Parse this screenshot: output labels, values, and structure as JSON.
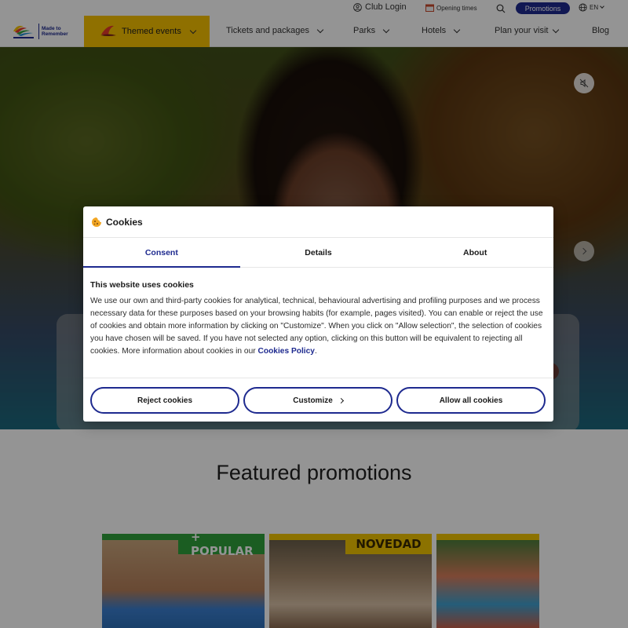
{
  "topbar": {
    "club_login": "Club Login",
    "opening_times": "Opening times",
    "promotions": "Promotions",
    "language": "EN"
  },
  "logo": {
    "tagline_1": "Made to",
    "tagline_2": "Remember"
  },
  "nav": {
    "items": [
      {
        "label": "Themed events"
      },
      {
        "label": "Tickets and packages"
      },
      {
        "label": "Parks"
      },
      {
        "label": "Hotels"
      },
      {
        "label": "Plan your visit"
      },
      {
        "label": "Blog"
      }
    ]
  },
  "main": {
    "featured_title": "Featured promotions",
    "promo_cards": [
      {
        "badge": "+ POPULAR"
      },
      {
        "badge": "NOVEDAD"
      },
      {
        "badge": ""
      }
    ]
  },
  "cookie_modal": {
    "title": "Cookies",
    "tabs": [
      {
        "label": "Consent",
        "active": true
      },
      {
        "label": "Details",
        "active": false
      },
      {
        "label": "About",
        "active": false
      }
    ],
    "heading": "This website uses cookies",
    "body": "We use our own and third-party cookies for analytical, technical, behavioural advertising and profiling purposes and we process necessary data for these purposes based on your browsing habits (for example, pages visited). You can enable or reject the use of cookies and obtain more information by clicking on \"Customize\". When you click on \"Allow selection\", the selection of cookies you have chosen will be saved. If you have not selected any option, clicking on this button will be equivalent to rejecting all cookies. More information about cookies in our",
    "policy_link": "Cookies Policy",
    "buttons": {
      "reject": "Reject cookies",
      "customize": "Customize",
      "allow": "Allow all cookies"
    }
  },
  "colors": {
    "brand_blue": "#1e2a8f",
    "themed_yellow": "#f7c200",
    "popular_green": "#2fa13b"
  }
}
